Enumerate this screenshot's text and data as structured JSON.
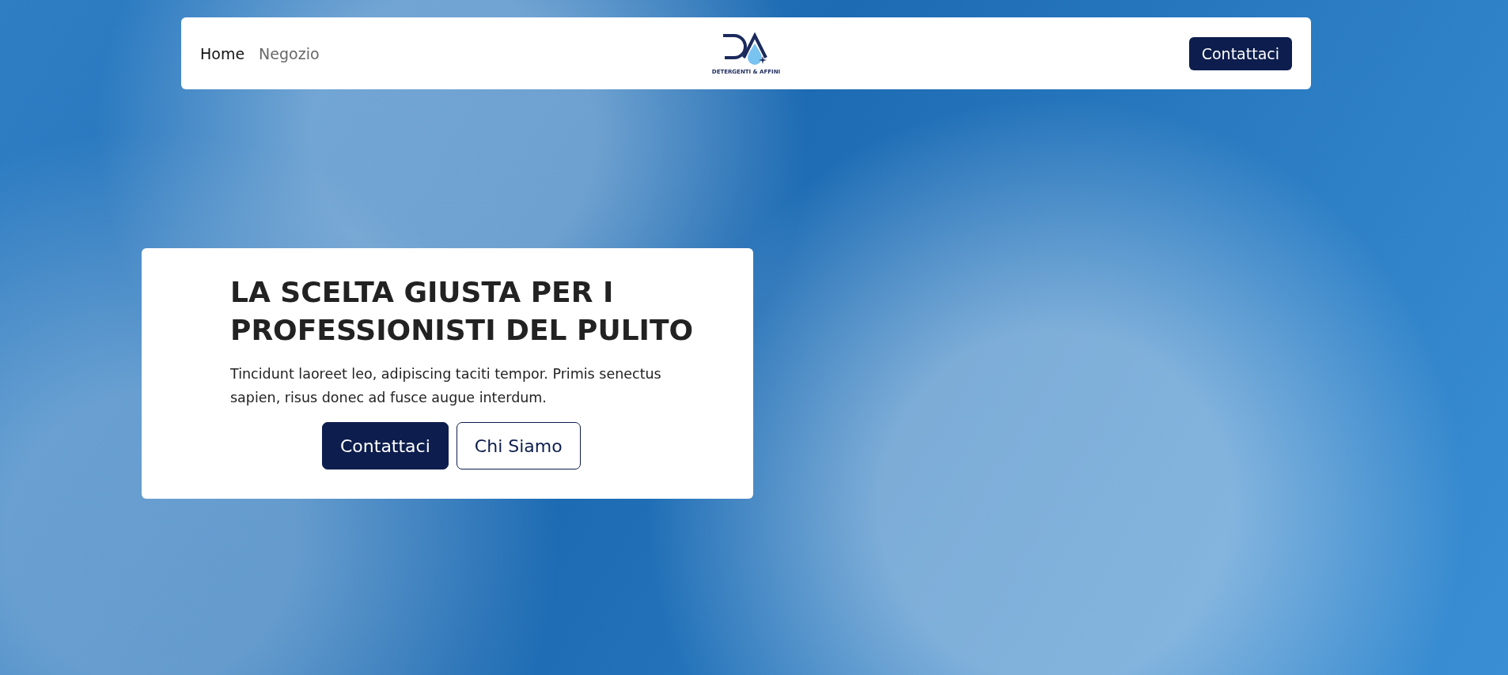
{
  "nav": {
    "links": [
      {
        "label": "Home",
        "selected": true
      },
      {
        "label": "Negozio",
        "selected": false
      }
    ],
    "logo": {
      "tagline": "DETERGENTI & AFFINI"
    },
    "cta": "Contattaci"
  },
  "hero": {
    "title": "LA SCELTA GIUSTA PER I PROFESSIONISTI DEL PULITO",
    "text": "Tincidunt laoreet leo, adipiscing taciti tempor. Primis senectus sapien, risus donec ad fusce augue interdum.",
    "buttons": [
      {
        "label": "Contattaci",
        "kind": "primary"
      },
      {
        "label": "Chi Siamo",
        "kind": "outline"
      }
    ]
  }
}
